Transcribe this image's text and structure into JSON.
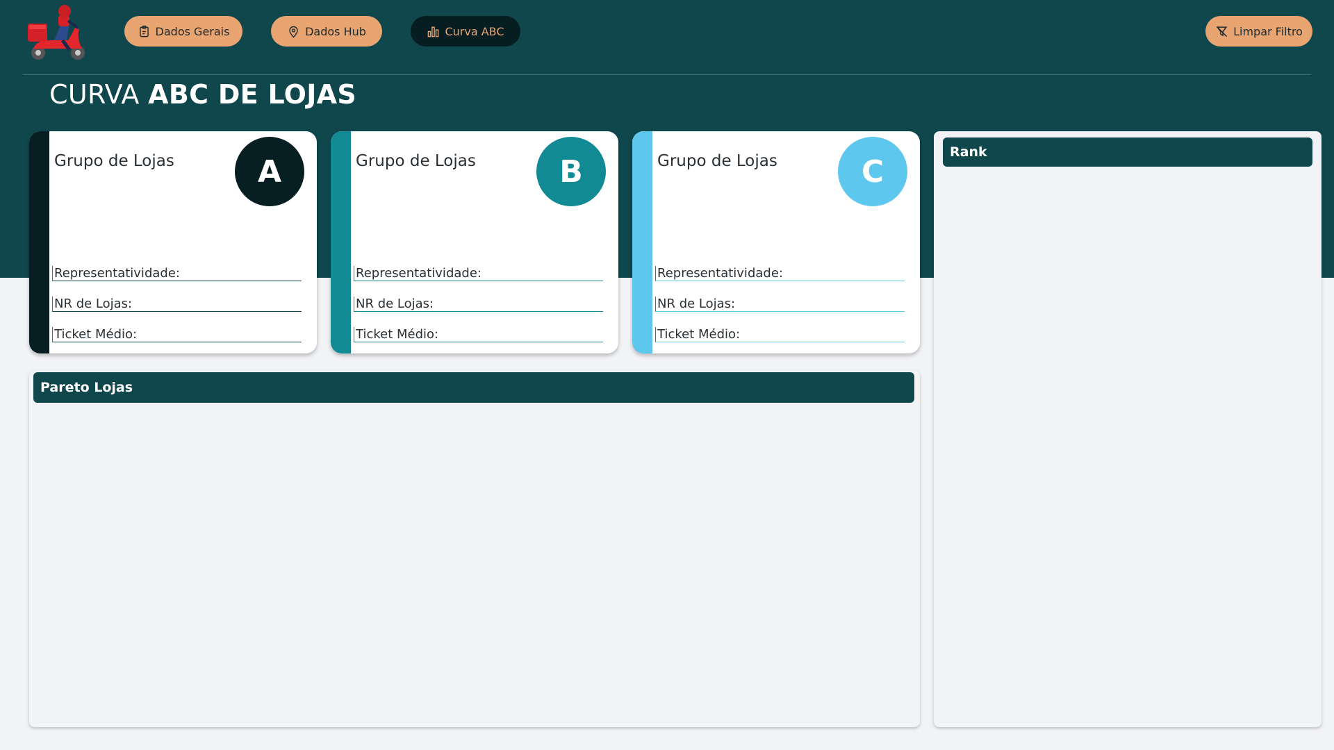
{
  "nav": {
    "buttons": [
      {
        "label": "Dados Gerais",
        "icon": "clipboard-icon"
      },
      {
        "label": "Dados Hub",
        "icon": "map-pin-icon"
      },
      {
        "label": "Curva ABC",
        "icon": "bar-chart-icon"
      }
    ],
    "clear_filter": {
      "label": "Limpar Filtro",
      "icon": "filter-off-icon"
    }
  },
  "page_title": {
    "light": "CURVA ",
    "bold": "ABC DE LOJAS"
  },
  "groups": [
    {
      "title": "Grupo de Lojas",
      "letter": "A",
      "color": "#071f22",
      "fields": {
        "representatividade": "Representatividade:",
        "nr_lojas": "NR de Lojas:",
        "ticket": "Ticket Médio:"
      }
    },
    {
      "title": "Grupo de Lojas",
      "letter": "B",
      "color": "#128a93",
      "fields": {
        "representatividade": "Representatividade:",
        "nr_lojas": "NR de Lojas:",
        "ticket": "Ticket Médio:"
      }
    },
    {
      "title": "Grupo de Lojas",
      "letter": "C",
      "color": "#5ec7ee",
      "fields": {
        "representatividade": "Representatividade:",
        "nr_lojas": "NR de Lojas:",
        "ticket": "Ticket Médio:"
      }
    }
  ],
  "pareto": {
    "title": "Pareto Lojas"
  },
  "rank": {
    "title": "Rank"
  },
  "colors": {
    "header_bg": "#0f474d",
    "button_accent": "#e8a572",
    "button_dark": "#061d21",
    "page_bg": "#f2f3f6"
  }
}
